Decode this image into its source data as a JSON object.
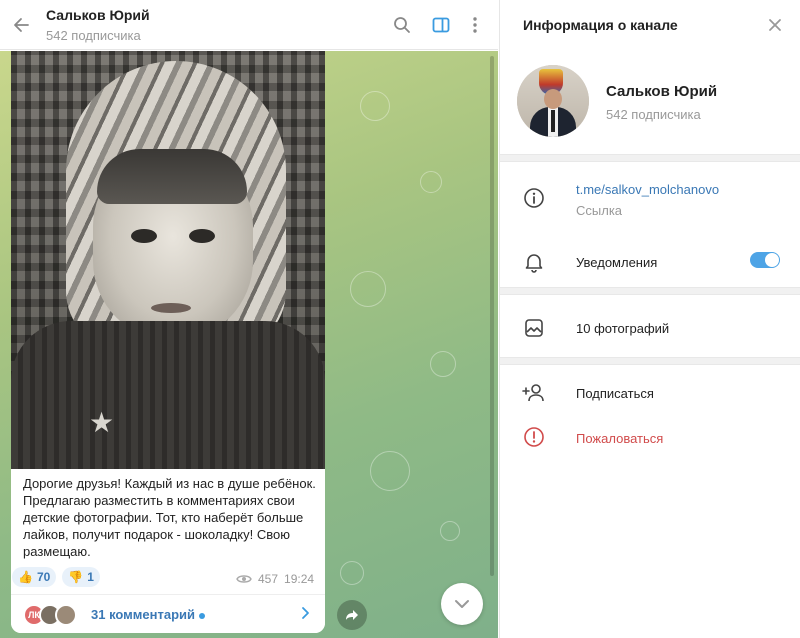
{
  "chat": {
    "title": "Сальков Юрий",
    "subtitle": "542 подписчика"
  },
  "message": {
    "text": "Дорогие друзья! Каждый из нас в душе ребёнок. Предлагаю разместить в комментариях свои детские фотографии. Тот, кто наберёт больше лайков, получит подарок - шоколадку! Свою размещаю.",
    "reactions": [
      {
        "emoji": "👍",
        "count": "70"
      },
      {
        "emoji": "👎",
        "count": "1"
      }
    ],
    "views": "457",
    "time": "19:24",
    "comments": {
      "label": "31 комментарий",
      "avatar_initials": "ЛК"
    }
  },
  "panel": {
    "title": "Информация о канале",
    "profile": {
      "name": "Сальков Юрий",
      "subtitle": "542 подписчика"
    },
    "link": {
      "value": "t.me/salkov_molchanovo",
      "label": "Ссылка"
    },
    "notifications": {
      "label": "Уведомления",
      "enabled": true
    },
    "photos": {
      "label": "10 фотографий"
    },
    "subscribe": {
      "label": "Подписаться"
    },
    "report": {
      "label": "Пожаловаться"
    }
  },
  "colors": {
    "accent": "#3a78b5",
    "toggle": "#4ea4e6",
    "danger": "#d14b4b"
  }
}
